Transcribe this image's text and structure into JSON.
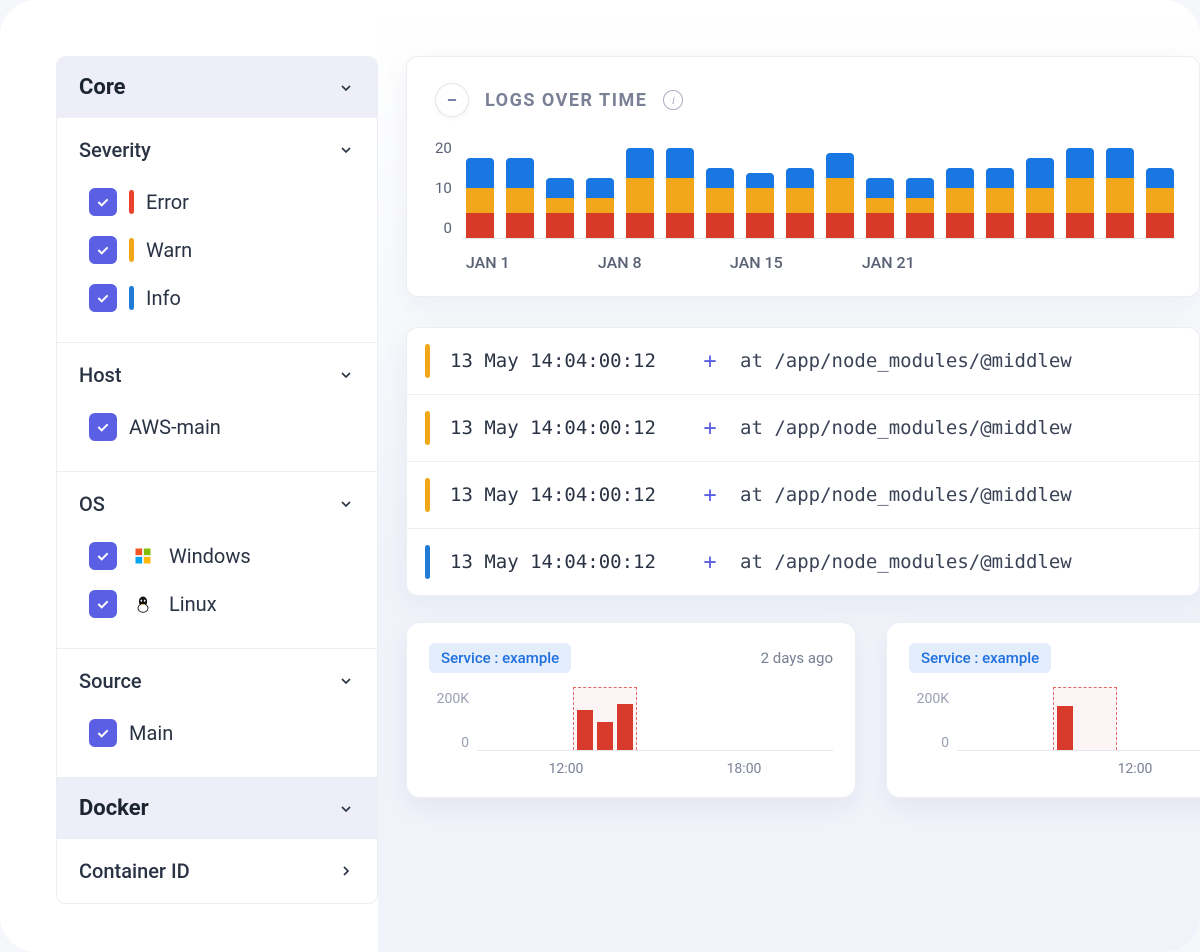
{
  "sidebar": {
    "groups": [
      {
        "title": "Core",
        "sections": [
          {
            "title": "Severity",
            "items": [
              {
                "label": "Error",
                "checked": true,
                "color": "error"
              },
              {
                "label": "Warn",
                "checked": true,
                "color": "warn"
              },
              {
                "label": "Info",
                "checked": true,
                "color": "info"
              }
            ]
          },
          {
            "title": "Host",
            "items": [
              {
                "label": "AWS-main",
                "checked": true
              }
            ]
          },
          {
            "title": "OS",
            "items": [
              {
                "label": "Windows",
                "checked": true,
                "icon": "windows"
              },
              {
                "label": "Linux",
                "checked": true,
                "icon": "linux"
              }
            ]
          },
          {
            "title": "Source",
            "items": [
              {
                "label": "Main",
                "checked": true
              }
            ]
          }
        ]
      },
      {
        "title": "Docker",
        "sections": [
          {
            "title": "Container ID",
            "items": []
          }
        ]
      }
    ]
  },
  "chart": {
    "title": "LOGS OVER TIME",
    "y_ticks": [
      "20",
      "10",
      "0"
    ],
    "x_ticks": [
      "JAN 1",
      "JAN 8",
      "JAN 15",
      "JAN 21"
    ]
  },
  "chart_data": {
    "type": "bar",
    "stacked": true,
    "ylabel": "",
    "xlabel": "",
    "ylim": [
      0,
      20
    ],
    "x_ticks": [
      "JAN 1",
      "JAN 8",
      "JAN 15",
      "JAN 21"
    ],
    "categories": [
      1,
      2,
      3,
      4,
      5,
      6,
      7,
      8,
      9,
      10,
      11,
      12,
      13,
      14,
      15,
      16,
      17,
      18
    ],
    "series": [
      {
        "name": "Error",
        "color": "#d83a2a",
        "values": [
          5,
          5,
          5,
          5,
          5,
          5,
          5,
          5,
          5,
          5,
          5,
          5,
          5,
          5,
          5,
          5,
          5,
          5
        ]
      },
      {
        "name": "Warn",
        "color": "#f2a71b",
        "values": [
          5,
          5,
          3,
          3,
          7,
          7,
          5,
          5,
          5,
          7,
          3,
          3,
          5,
          5,
          5,
          7,
          7,
          5
        ]
      },
      {
        "name": "Info",
        "color": "#1877e3",
        "values": [
          6,
          6,
          4,
          4,
          6,
          6,
          4,
          3,
          4,
          5,
          4,
          4,
          4,
          4,
          6,
          6,
          6,
          4
        ]
      }
    ]
  },
  "logs": [
    {
      "severity": "warn",
      "ts": "13 May 14:04:00:12",
      "msg": "at /app/node_modules/@middlew"
    },
    {
      "severity": "warn",
      "ts": "13 May 14:04:00:12",
      "msg": "at /app/node_modules/@middlew"
    },
    {
      "severity": "warn",
      "ts": "13 May 14:04:00:12",
      "msg": "at /app/node_modules/@middlew"
    },
    {
      "severity": "info",
      "ts": "13 May 14:04:00:12",
      "msg": "at /app/node_modules/@middlew"
    }
  ],
  "mini_cards": [
    {
      "service_label": "Service : example",
      "age": "2 days ago",
      "y_ticks": [
        "200K",
        "0"
      ],
      "x_ticks": [
        "12:00",
        "18:00"
      ],
      "bars": [
        40,
        28,
        46
      ]
    },
    {
      "service_label": "Service : example",
      "age": "",
      "y_ticks": [
        "200K",
        "0"
      ],
      "x_ticks": [
        "12:00"
      ],
      "bars": [
        44
      ]
    }
  ]
}
